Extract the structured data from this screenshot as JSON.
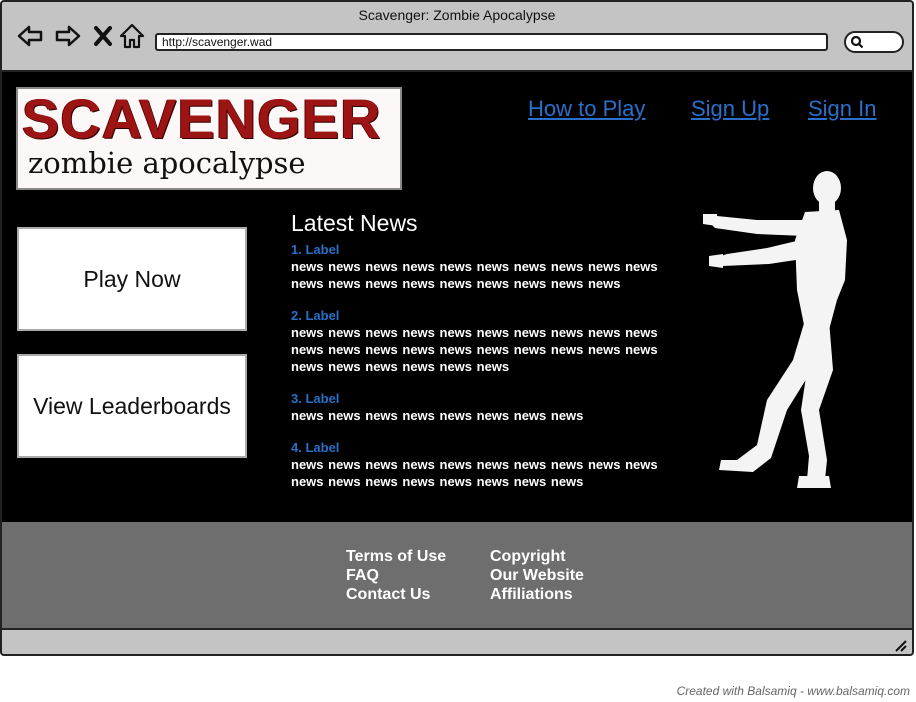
{
  "window": {
    "title": "Scavenger: Zombie Apocalypse"
  },
  "browser": {
    "url": "http://scavenger.wad",
    "nav_icons": [
      "back-arrow-icon",
      "forward-arrow-icon",
      "close-x-icon",
      "home-icon"
    ],
    "search_icon": "search-icon"
  },
  "logo": {
    "title": "SCAVENGER",
    "subtitle": "zombie apocalypse"
  },
  "topnav": {
    "how_to_play": "How to Play",
    "sign_up": "Sign Up",
    "sign_in": "Sign In"
  },
  "buttons": {
    "play_now": "Play Now",
    "leaderboards": "View Leaderboards"
  },
  "news": {
    "heading": "Latest News",
    "items": [
      {
        "label": "1. Label",
        "text": "news news news news news news news news news news news news news news news news news news news"
      },
      {
        "label": "2. Label",
        "text": "news news news news news news news news news news news news news news news news news news news news news news news news news news"
      },
      {
        "label": "3. Label",
        "text": "news news news news news news news news"
      },
      {
        "label": "4. Label",
        "text": "news news news news news news news news news news news news news news news news news news"
      }
    ]
  },
  "footer": {
    "col1": [
      "Terms of Use",
      "FAQ",
      "Contact Us"
    ],
    "col2": [
      "Copyright",
      "Our Website",
      "Affiliations"
    ]
  },
  "credit": "Created with Balsamiq - www.balsamiq.com",
  "colors": {
    "link": "#2a6fc9",
    "page_bg": "#000000",
    "footer_bg": "#6e6e6e",
    "chrome": "#c4c4c4",
    "logo_red": "#9c1414"
  }
}
